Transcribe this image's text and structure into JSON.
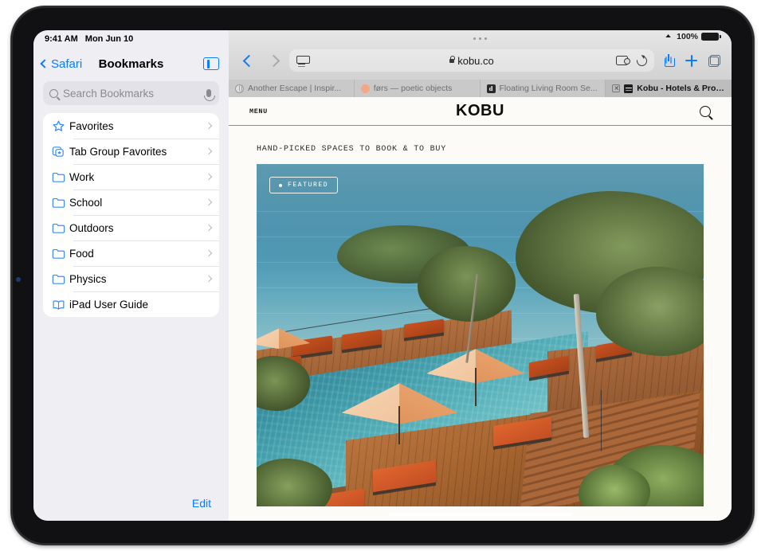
{
  "status_bar": {
    "time": "9:41 AM",
    "date": "Mon Jun 10",
    "wifi_icon": "wifi-icon",
    "battery_percent": "100%",
    "battery_icon": "battery-full-icon"
  },
  "sidebar": {
    "back_label": "Safari",
    "title": "Bookmarks",
    "toggle_icon": "sidebar-toggle-icon",
    "search": {
      "placeholder": "Search Bookmarks",
      "search_icon": "search-icon",
      "mic_icon": "microphone-icon"
    },
    "items": [
      {
        "label": "Favorites",
        "icon": "star-icon",
        "chevron": true
      },
      {
        "label": "Tab Group Favorites",
        "icon": "tab-group-star-icon",
        "chevron": true
      },
      {
        "label": "Work",
        "icon": "folder-icon",
        "chevron": true
      },
      {
        "label": "School",
        "icon": "folder-icon",
        "chevron": true
      },
      {
        "label": "Outdoors",
        "icon": "folder-icon",
        "chevron": true
      },
      {
        "label": "Food",
        "icon": "folder-icon",
        "chevron": true
      },
      {
        "label": "Physics",
        "icon": "folder-icon",
        "chevron": true
      },
      {
        "label": "iPad User Guide",
        "icon": "book-icon",
        "chevron": false
      }
    ],
    "edit_label": "Edit"
  },
  "browser": {
    "back_icon": "back-chevron-icon",
    "forward_icon": "forward-chevron-icon",
    "address": {
      "page_settings_icon": "page-settings-icon",
      "lock_icon": "lock-icon",
      "url": "kobu.co",
      "extensions_icon": "extensions-puzzle-icon",
      "reload_icon": "reload-icon"
    },
    "actions": {
      "share_icon": "share-icon",
      "new_tab_icon": "new-tab-plus-icon",
      "tabs_overview_icon": "tabs-overview-icon"
    },
    "tabs": [
      {
        "title": "Another Escape | Inspir...",
        "favicon": "globe-icon",
        "active": false,
        "has_close": false
      },
      {
        "title": "førs — poetic objects",
        "favicon": "orange-dot-icon",
        "active": false,
        "has_close": false
      },
      {
        "title": "Floating Living Room Se...",
        "favicon": "dezeen-d-icon",
        "active": false,
        "has_close": false
      },
      {
        "title": "Kobu - Hotels & Propert...",
        "favicon": "kobu-icon",
        "active": true,
        "has_close": true
      }
    ]
  },
  "webpage": {
    "menu_label": "MENU",
    "logo": "KOBU",
    "search_icon": "search-icon",
    "tagline": "HAND-PICKED SPACES TO BOOK & TO BUY",
    "hero": {
      "badge_label": "FEATURED",
      "badge_dot_icon": "bullet-dot-icon",
      "alt": "Infinity pool resort deck overlooking the ocean with orange umbrellas and loungers"
    }
  },
  "home_indicator": "home-indicator"
}
